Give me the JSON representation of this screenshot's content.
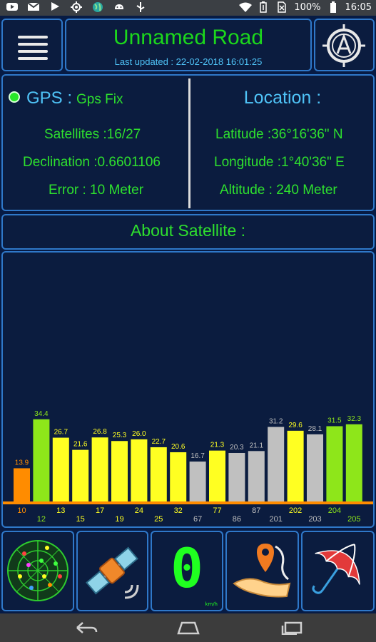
{
  "status_bar": {
    "battery_percent": "100%",
    "time": "16:05",
    "left_icons": [
      "youtube-icon",
      "gmail-icon",
      "play-store-icon",
      "gps-target-icon",
      "globe-icon",
      "android-icon",
      "usb-icon"
    ],
    "right_icons": [
      "wifi-icon",
      "battery-saver-icon",
      "no-sim-icon",
      "battery-icon"
    ]
  },
  "header": {
    "title": "Unnamed Road",
    "last_updated": "Last updated : 22-02-2018 16:01:25"
  },
  "gps": {
    "label": "GPS :",
    "status": "Gps Fix",
    "satellites": "Satellites :16/27",
    "declination": "Declination :0.6601106",
    "error": "Error : 10 Meter"
  },
  "location": {
    "title": "Location :",
    "latitude": "Latitude :36°16'36\" N",
    "longitude": "Longitude :1°40'36\" E",
    "altitude": "Altitude : 240 Meter"
  },
  "about": {
    "title": "About Satellite :"
  },
  "chart_data": {
    "type": "bar",
    "categories": [
      "10",
      "12",
      "13",
      "15",
      "17",
      "19",
      "24",
      "25",
      "32",
      "67",
      "77",
      "86",
      "87",
      "201",
      "202",
      "203",
      "204",
      "205"
    ],
    "values": [
      13.9,
      34.4,
      26.7,
      21.6,
      26.8,
      25.3,
      26.0,
      22.7,
      20.6,
      16.7,
      21.3,
      20.3,
      21.1,
      31.2,
      29.6,
      28.1,
      31.5,
      32.3
    ],
    "colors": [
      "#ff8c00",
      "#8ee61a",
      "#ffff22",
      "#ffff22",
      "#ffff22",
      "#ffff22",
      "#ffff22",
      "#ffff22",
      "#ffff22",
      "#c0c0c0",
      "#ffff22",
      "#c0c0c0",
      "#c0c0c0",
      "#c0c0c0",
      "#ffff22",
      "#c0c0c0",
      "#8ee61a",
      "#8ee61a"
    ],
    "title": "",
    "xlabel": "",
    "ylabel": "",
    "ylim": [
      0,
      100
    ]
  },
  "bottom_buttons": [
    {
      "name": "skyview-button",
      "icon": "satellite-skyview-icon"
    },
    {
      "name": "satellite-button",
      "icon": "satellite-icon"
    },
    {
      "name": "speedometer-button",
      "icon": "speedometer-icon",
      "digit": "0",
      "unit": "km/h"
    },
    {
      "name": "map-location-button",
      "icon": "map-pin-hand-icon"
    },
    {
      "name": "weather-button",
      "icon": "umbrella-icon"
    }
  ],
  "nav_bar": {
    "icons": [
      "back-icon",
      "home-icon",
      "recents-icon"
    ]
  }
}
